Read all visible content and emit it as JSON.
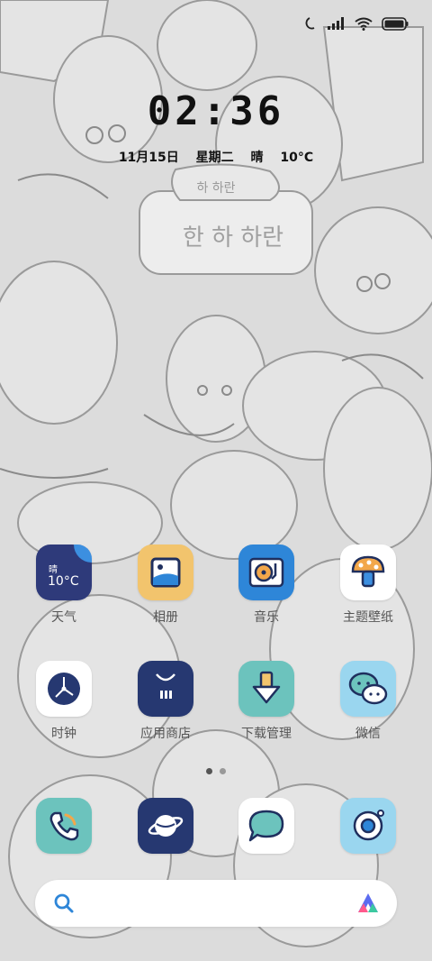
{
  "clock": {
    "time": "02:36"
  },
  "date_line": {
    "date": "11月15日",
    "weekday": "星期二",
    "weather": "晴",
    "temperature": "10°C"
  },
  "wallpaper": {
    "sign_text_small": "하 하란",
    "sign_text_large": "한 하 하란"
  },
  "weather_widget": {
    "condition": "晴",
    "temperature": "10°C"
  },
  "apps_row1": [
    {
      "label": "天气",
      "icon": "weather-icon"
    },
    {
      "label": "相册",
      "icon": "gallery-icon"
    },
    {
      "label": "音乐",
      "icon": "music-icon"
    },
    {
      "label": "主题壁纸",
      "icon": "themes-icon"
    }
  ],
  "apps_row2": [
    {
      "label": "时钟",
      "icon": "clock-icon"
    },
    {
      "label": "应用商店",
      "icon": "app-store-icon"
    },
    {
      "label": "下载管理",
      "icon": "download-icon"
    },
    {
      "label": "微信",
      "icon": "wechat-icon"
    }
  ],
  "dock": [
    {
      "icon": "phone-icon"
    },
    {
      "icon": "browser-icon"
    },
    {
      "icon": "messages-icon"
    },
    {
      "icon": "camera-icon"
    }
  ],
  "page_indicator": {
    "pages": 2,
    "current": 1
  },
  "colors": {
    "weather_bg": "#2e3a7a",
    "gallery_bg": "#f2c46d",
    "music_bg": "#2e86d8",
    "clock_bg": "#ffffff",
    "store_bg": "#263871",
    "download_bg": "#6cc3bd",
    "wechat_bg": "#9ad6ef",
    "phone_bg": "#6cc3bd",
    "browser_bg": "#263871",
    "camera_bg": "#9ad6ef"
  }
}
